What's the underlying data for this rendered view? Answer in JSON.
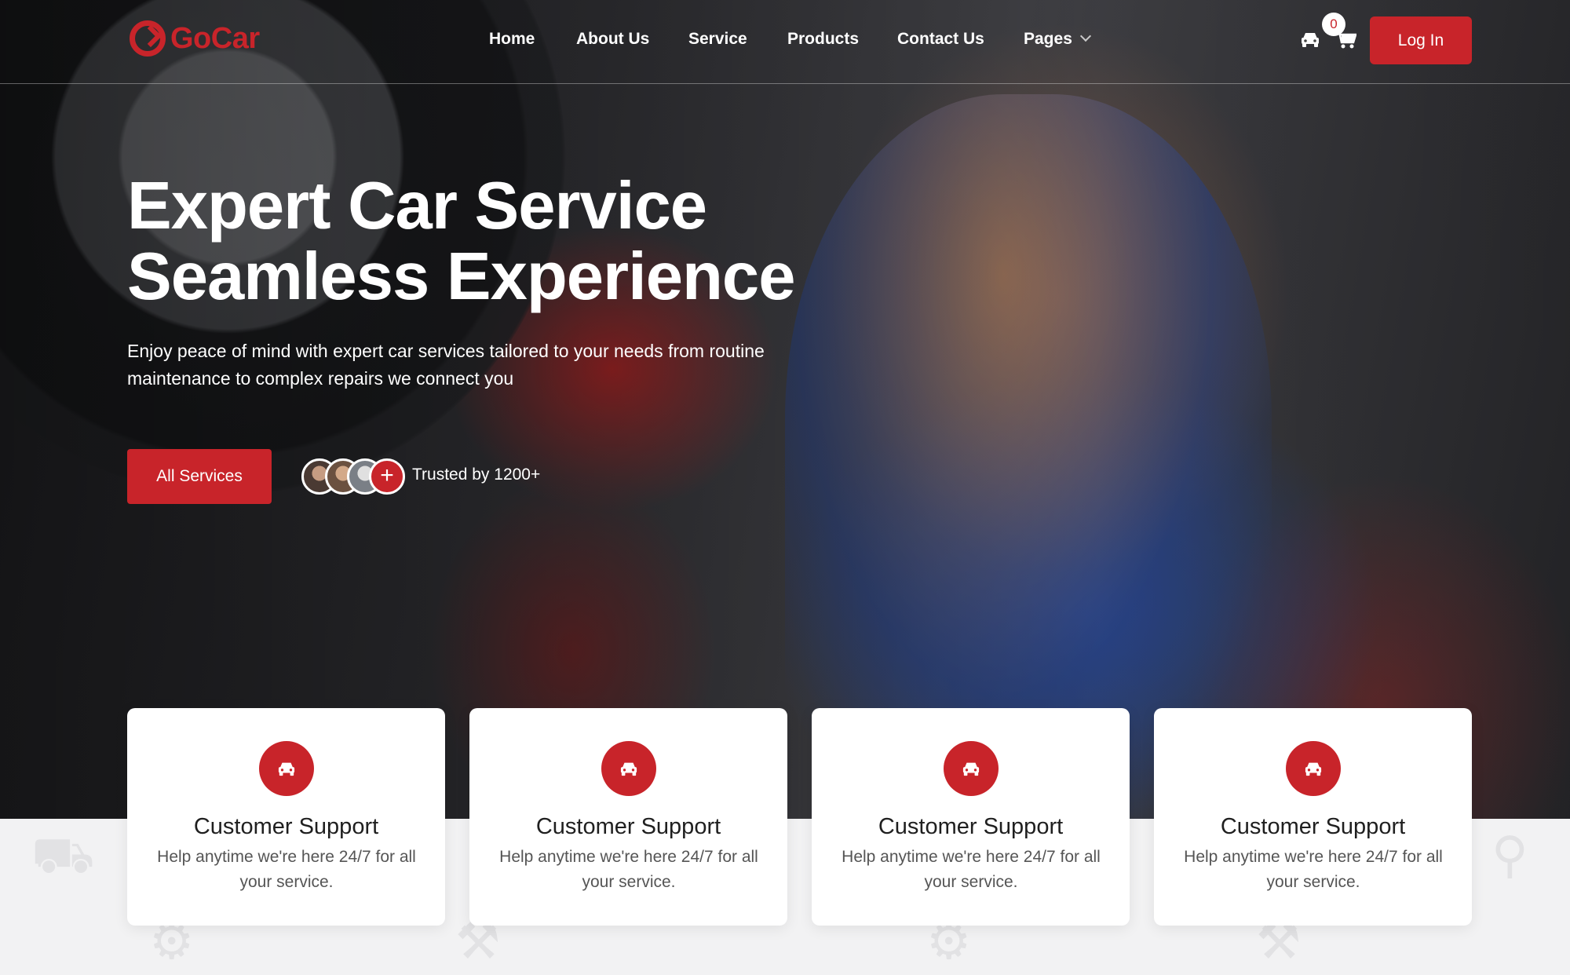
{
  "brand": {
    "name": "GoCar",
    "accent": "#c8242a"
  },
  "nav": {
    "items": [
      {
        "label": "Home"
      },
      {
        "label": "About Us"
      },
      {
        "label": "Service"
      },
      {
        "label": "Products"
      },
      {
        "label": "Contact Us"
      },
      {
        "label": "Pages"
      }
    ],
    "cart_count": "0",
    "login_label": "Log In",
    "icons": [
      "car-icon",
      "cart-icon",
      "chevron-down-icon"
    ]
  },
  "hero": {
    "title_line1": "Expert Car Service",
    "title_line2": "Seamless Experience",
    "description": "Enjoy peace of mind with expert car services tailored to your needs from routine maintenance to complex repairs we connect you",
    "cta_label": "All Services",
    "trusted_text": "Trusted by 1200+",
    "plus_symbol": "+"
  },
  "features": [
    {
      "icon": "car-icon",
      "title": "Customer Support",
      "description": "Help anytime we're here 24/7 for all your service."
    },
    {
      "icon": "car-icon",
      "title": "Customer Support",
      "description": "Help anytime we're here 24/7 for all your service."
    },
    {
      "icon": "car-icon",
      "title": "Customer Support",
      "description": "Help anytime we're here 24/7 for all your service."
    },
    {
      "icon": "car-icon",
      "title": "Customer Support",
      "description": "Help anytime we're here 24/7 for all your service."
    }
  ]
}
